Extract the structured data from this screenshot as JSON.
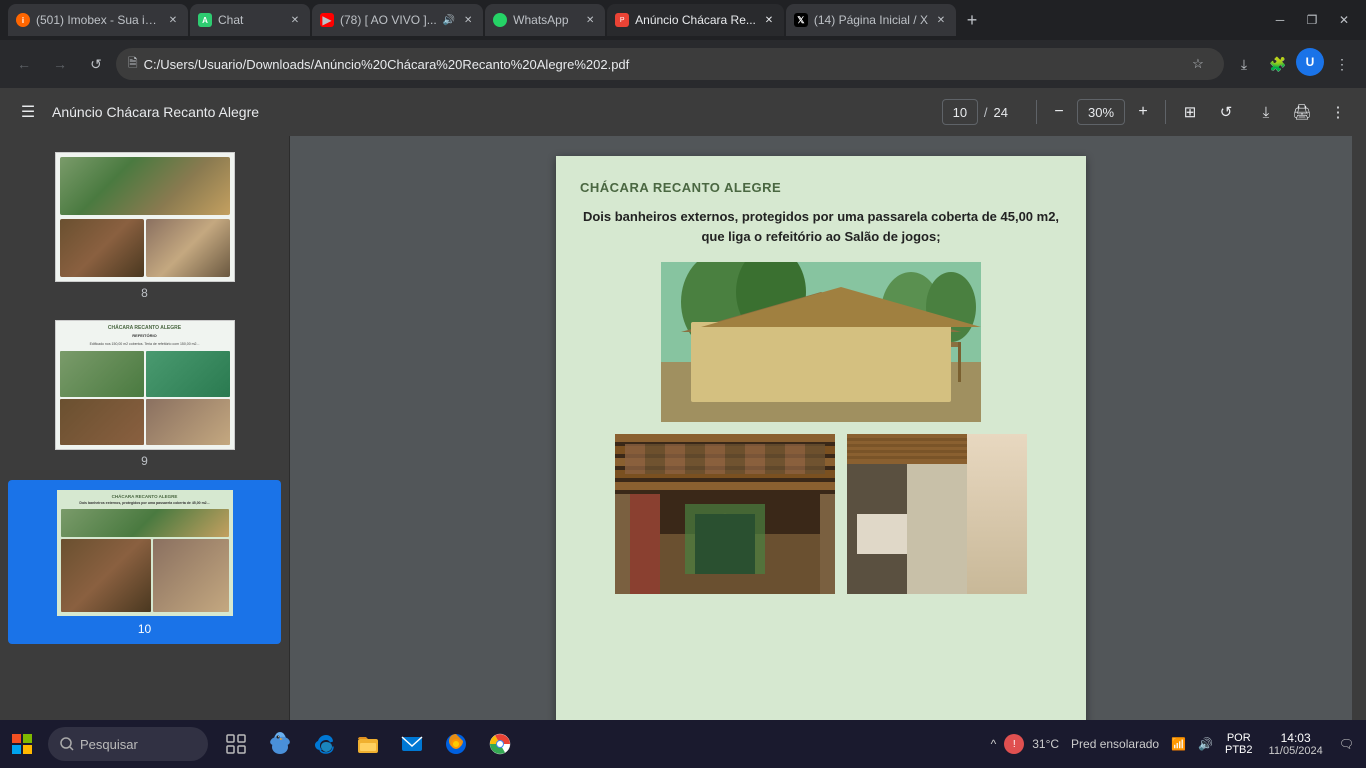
{
  "browser": {
    "tabs": [
      {
        "id": "imobex",
        "title": "(501) Imobex - Sua in...",
        "favicon": "imobex",
        "active": false,
        "audio": false
      },
      {
        "id": "chat",
        "title": "Chat",
        "favicon": "chat",
        "active": false,
        "audio": false
      },
      {
        "id": "youtube",
        "title": "(78) [ AO VIVO ]...",
        "favicon": "yt",
        "active": false,
        "audio": true
      },
      {
        "id": "whatsapp",
        "title": "WhatsApp",
        "favicon": "wa",
        "active": false,
        "audio": false
      },
      {
        "id": "pdf",
        "title": "Anúncio Chácara Re...",
        "favicon": "pdf",
        "active": true,
        "audio": false
      },
      {
        "id": "twitter",
        "title": "(14) Página Inicial / X",
        "favicon": "x",
        "active": false,
        "audio": false
      }
    ],
    "url": "C:/Users/Usuario/Downloads/Anúncio%20Chácara%20Recanto%20Alegre%202.pdf",
    "url_display": "C:/Users/Usuario/Downloads/Anúncio%20Chácara%20Recanto%20Alegre%202.pdf"
  },
  "pdf": {
    "toolbar": {
      "title": "Anúncio Chácara Recanto Alegre",
      "current_page": "10",
      "total_pages": "24",
      "zoom": "30%",
      "zoom_value": "30",
      "download_label": "Download",
      "print_label": "Print",
      "more_label": "More"
    },
    "thumbnails": [
      {
        "page": 8
      },
      {
        "page": 9
      },
      {
        "page": 10,
        "active": true
      }
    ],
    "page": {
      "heading": "CHÁCARA RECANTO ALEGRE",
      "description": "Dois banheiros externos, protegidos por uma passarela coberta de 45,00 m2, que liga o refeitório ao Salão de jogos;"
    }
  },
  "taskbar": {
    "search_placeholder": "Pesquisar",
    "temp": "31°C",
    "weather": "Pred ensolarado",
    "language": "POR",
    "region": "PTB2",
    "time": "14:03",
    "date": "11/05/2024",
    "notifications_icon": "🔔"
  }
}
